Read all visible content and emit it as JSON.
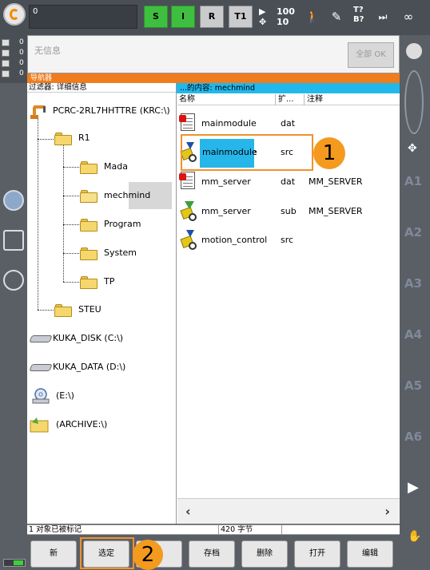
{
  "topbar": {
    "program_field": "0",
    "status_S": "S",
    "status_I": "I",
    "status_R": "R",
    "mode": "T1",
    "override_prog": "100",
    "override_jog": "10",
    "tool_label_top": "T?",
    "tool_label_bottom": "B?",
    "inc_label": "∞"
  },
  "messages": {
    "counts": [
      "0",
      "0",
      "0",
      "0"
    ],
    "text": "无信息",
    "ok_all_button": "全部 OK"
  },
  "navigator": {
    "title": "导航器",
    "filter_label": "过滤器: 详细信息",
    "content_label": "...的内容: mechmind",
    "tree": {
      "root": "PCRC-2RL7HHTTRE (KRC:\\)",
      "r1": "R1",
      "children": [
        "Mada",
        "mechmind",
        "Program",
        "System",
        "TP"
      ],
      "steu": "STEU",
      "drives": [
        "KUKA_DISK (C:\\)",
        "KUKA_DATA (D:\\)",
        "(E:\\)",
        "(ARCHIVE:\\)"
      ]
    },
    "columns": {
      "name": "名称",
      "ext": "扩...",
      "comment": "注释"
    },
    "files": [
      {
        "name": "mainmodule",
        "ext": "dat",
        "comment": "",
        "icon": "dat-file-icon"
      },
      {
        "name": "mainmodule",
        "ext": "src",
        "comment": "",
        "icon": "src-file-icon"
      },
      {
        "name": "mm_server",
        "ext": "dat",
        "comment": "MM_SERVER",
        "icon": "dat-file-icon"
      },
      {
        "name": "mm_server",
        "ext": "sub",
        "comment": "MM_SERVER",
        "icon": "sub-file-icon"
      },
      {
        "name": "motion_control",
        "ext": "src",
        "comment": "",
        "icon": "src-file-icon"
      }
    ]
  },
  "status": {
    "marked": "1 对象已被标记",
    "size": "420 字节"
  },
  "softkeys": [
    "新",
    "选定",
    "",
    "存档",
    "删除",
    "打开",
    "编辑"
  ],
  "annotations": {
    "badge1": "1",
    "badge2": "2"
  },
  "right_axes": [
    "A1",
    "A2",
    "A3",
    "A4",
    "A5",
    "A6"
  ],
  "colors": {
    "accent_orange": "#f07c1e",
    "selection_blue": "#26b6ea",
    "status_green": "#3fbf3f",
    "annotation_orange": "#f39a1f"
  }
}
